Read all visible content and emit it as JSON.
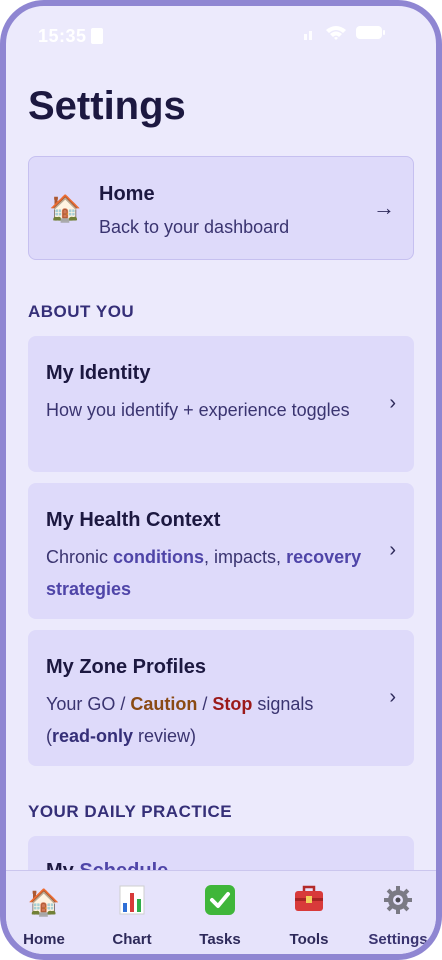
{
  "status_bar": {
    "time": "15:35"
  },
  "page_title": "Settings",
  "home_card": {
    "icon": "🏠",
    "title": "Home",
    "subtitle": "Back to your dashboard",
    "arrow": "→"
  },
  "sections": {
    "about_you": "ABOUT YOU",
    "daily_practice": "YOUR DAILY PRACTICE"
  },
  "cards": {
    "identity": {
      "title": "My Identity",
      "subtitle": "How you identify + experience toggles"
    },
    "health": {
      "title": "My Health Context",
      "sub_1": "Chronic ",
      "sub_2": "conditions",
      "sub_3": ", impacts, ",
      "sub_4": "recovery strategies"
    },
    "zones": {
      "title": "My Zone Profiles",
      "sub_1": "Your GO / ",
      "sub_2": "Caution",
      "sub_3": " / ",
      "sub_4": "Stop",
      "sub_5": " signals (",
      "sub_6": "read-only",
      "sub_7": " review)"
    },
    "schedule": {
      "title_1": "My ",
      "title_2": "Schedule"
    }
  },
  "chevron": "›",
  "tabs": [
    {
      "label": "Home",
      "icon": "🏠"
    },
    {
      "label": "Chart",
      "icon": "📊"
    },
    {
      "label": "Tasks",
      "icon": "✅"
    },
    {
      "label": "Tools",
      "icon": "🧰"
    },
    {
      "label": "Settings",
      "icon": "⚙️"
    }
  ],
  "active_tab": "Settings",
  "colors": {
    "background": "#eceafc",
    "card": "#dedafa",
    "accent": "#4f45a8",
    "caution": "#8a4a14",
    "stop": "#9b1a1a",
    "frame": "#8f86d2"
  }
}
